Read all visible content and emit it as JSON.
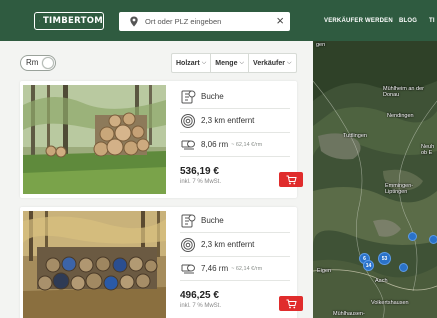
{
  "header": {
    "logo_text": "TIMBERTOM",
    "search_placeholder": "Ort oder PLZ eingeben",
    "clear_symbol": "×",
    "nav": [
      "VERKÄUFER WERDEN",
      "BLOG",
      "TI"
    ]
  },
  "toolbar": {
    "toggle_label": "Rm",
    "filters": [
      {
        "label": "Holzart",
        "chevron": "⌵"
      },
      {
        "label": "Menge",
        "chevron": "⌵"
      },
      {
        "label": "Verkäufer",
        "chevron": "⌵"
      }
    ]
  },
  "listings": [
    {
      "species": "Buche",
      "distance": "2,3 km entfernt",
      "amount": "8,06 rm",
      "unit_price": "~ 62,14 €/rm",
      "price": "536,19 €",
      "vat": "inkl. 7 % MwSt."
    },
    {
      "species": "Buche",
      "distance": "2,3 km entfernt",
      "amount": "7,46 rm",
      "unit_price": "~ 62,14 €/rm",
      "price": "496,25 €",
      "vat": "inkl. 7 % MwSt."
    }
  ],
  "map": {
    "labels": [
      "gen",
      "Mühlheim an der Donau",
      "Nendingen",
      "Tuttlingen",
      "Neuh ob E",
      "Emmingen-Liptingen",
      "Eigen",
      "Aach",
      "Volkertshausen",
      "Mühlhausen-"
    ],
    "clusters": [
      "6",
      "14",
      "53",
      "",
      "",
      ""
    ]
  },
  "colors": {
    "header_bg": "#2f5b40",
    "cart_button": "#e02c2c",
    "map_cluster": "#2a72c9"
  },
  "icons": [
    "location-pin-icon",
    "close-icon",
    "tree-species-icon",
    "distance-icon",
    "wood-stack-icon",
    "shopping-cart-icon",
    "chevron-down-icon"
  ]
}
